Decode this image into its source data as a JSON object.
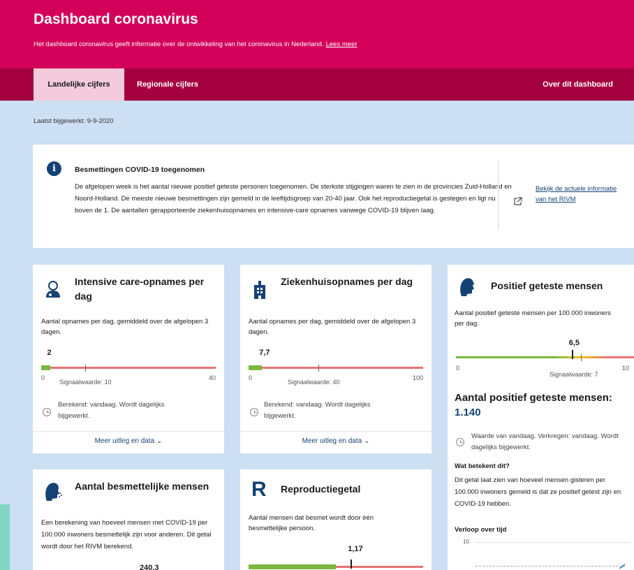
{
  "header": {
    "title": "Dashboard coronavirus",
    "intro": "Het dashboard coronavirus geeft informatie over de ontwikkeling van het coronavirus in Nederland.",
    "intro_link": "Lees meer"
  },
  "tabs": [
    {
      "label": "Landelijke cijfers",
      "active": true
    },
    {
      "label": "Regionale cijfers",
      "active": false
    },
    {
      "label": "Over dit dashboard",
      "active": false
    }
  ],
  "last_updated": "Laatst bijgewerkt: 9-9-2020",
  "alert": {
    "icon": "info-icon",
    "title": "Besmettingen COVID-19 toegenomen",
    "body": "De afgelopen week is het aantal nieuwe positief geteste personen toegenomen. De sterkste stijgingen waren te zien in de provincies Zuid-Holland en Noord-Holland. De meeste nieuwe besmettingen zijn gemeld in de leeftijdsgroep van 20-40 jaar. Ook het reproductiegetal is gestegen en ligt nu boven de 1. De aantallen gerapporteerde ziekenhuisopnames en intensive-care opnames vanwege COVID-19 blijven laag.",
    "link": "Bekijk de actuele informatie van het RIVM"
  },
  "cards": {
    "ic": {
      "icon": "doctor-icon",
      "title": "Intensive care-opnames per dag",
      "subtitle": "Aantal opnames per dag, gemiddeld over de afgelopen 3 dagen.",
      "value": "2",
      "value_num": 2,
      "min": "0",
      "max": "40",
      "max_num": 40,
      "threshold": "Signaalwaarde: 10",
      "threshold_num": 10,
      "note": "Berekend: vandaag. Wordt dagelijks bijgewerkt.",
      "more": "Meer uitleg en data"
    },
    "hosp": {
      "icon": "hospital-icon",
      "title": "Ziekenhuisopnames per dag",
      "subtitle": "Aantal opnames per dag, gemiddeld over de afgelopen 3 dagen.",
      "value": "7,7",
      "value_num": 7.7,
      "min": "0",
      "max": "100",
      "max_num": 100,
      "threshold": "Signaalwaarde: 40",
      "threshold_num": 40,
      "note": "Berekend: vandaag. Wordt dagelijks bijgewerkt.",
      "more": "Meer uitleg en data"
    },
    "pos": {
      "icon": "person-swab-icon",
      "title": "Positief geteste mensen",
      "subtitle": "Aantal positief geteste mensen per 100.000 inwoners per dag.",
      "value": "6,5",
      "value_num": 6.5,
      "min": "0",
      "max": "10",
      "max_num": 10,
      "threshold": "Signaalwaarde: 7",
      "threshold_num": 7,
      "count_title": "Aantal positief geteste mensen:",
      "count_value": "1.140",
      "note": "Waarde van vandaag. Verkregen: vandaag. Wordt dagelijks bijgewerkt.",
      "what_title": "Wat betekent dit?",
      "what_body": "Dit getal laat zien van hoeveel mensen gisteren per 100.000 inwoners gemeld is dat ze positief getest zijn en COVID-19 hebben.",
      "trend_title": "Verloop over tijd",
      "trend_axis": "10"
    },
    "infectious": {
      "icon": "person-sneeze-icon",
      "title": "Aantal besmettelijke mensen",
      "subtitle": "Een berekening van hoeveel mensen met COVID-19 per 100.000 inwoners besmettelijk zijn voor anderen. Dit getal wordt door het RIVM berekend.",
      "value": "240,3"
    },
    "repro": {
      "icon": "r-letter-icon",
      "title": "Reproductiegetal",
      "subtitle": "Aantal mensen dat besmet wordt door één besmettelijke persoon.",
      "value": "1,17",
      "value_num": 1.17,
      "max_num": 2,
      "threshold_num": 1
    }
  },
  "colors": {
    "header": "#d3005a",
    "tabs": "#a4003f",
    "active_tab": "#f4cbdc",
    "background": "#cddff3",
    "link": "#154273",
    "good": "#7bb83d",
    "bad": "#e57373"
  }
}
